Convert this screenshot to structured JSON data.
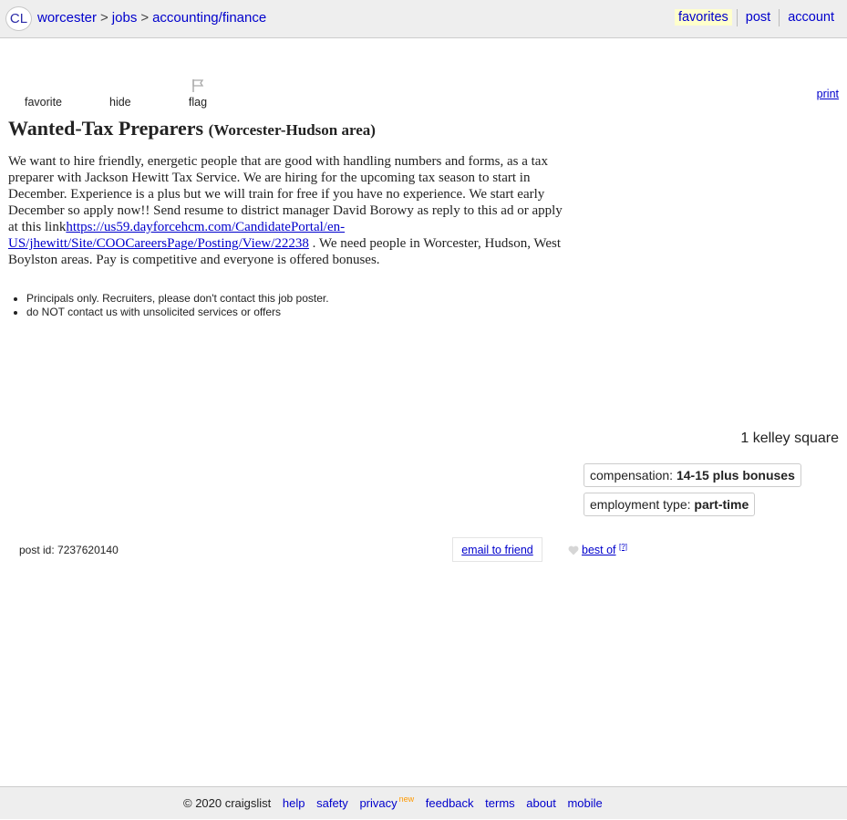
{
  "header": {
    "logo": "CL",
    "breadcrumbs": [
      "worcester",
      "jobs",
      "accounting/finance"
    ],
    "separator": ">",
    "links": {
      "favorites": "favorites",
      "post": "post",
      "account": "account"
    }
  },
  "actions": {
    "favorite": "favorite",
    "hide": "hide",
    "flag": "flag",
    "print": "print"
  },
  "post": {
    "title": "Wanted-Tax Preparers",
    "location": "(Worcester-Hudson area)",
    "body_before": "We want to hire friendly, energetic people that are good with handling numbers and forms, as a tax preparer with Jackson Hewitt Tax Service. We are hiring for the upcoming tax season to start in December. Experience is a plus but we will train for free if you have no experience. We start early December so apply now!! Send resume to district manager David Borowy as reply to this ad or apply at this link",
    "body_link": "https://us59.dayforcehcm.com/CandidatePortal/en-US/jhewitt/Site/COOCareersPage/Posting/View/22238",
    "body_after": " . We need people in Worcester, Hudson, West Boylston areas. Pay is competitive and everyone is offered bonuses.",
    "notices": [
      "Principals only. Recruiters, please don't contact this job poster.",
      "do NOT contact us with unsolicited services or offers"
    ]
  },
  "attributes": {
    "address": "1 kelley square",
    "compensation_label": "compensation: ",
    "compensation_value": "14-15 plus bonuses",
    "employment_label": "employment type: ",
    "employment_value": "part-time"
  },
  "postinfo": {
    "post_id": "post id: 7237620140",
    "email_friend": "email to friend",
    "best_of": "best of",
    "best_of_sup": "[?]"
  },
  "footer": {
    "copyright": "© 2020 craigslist",
    "links": [
      "help",
      "safety",
      "privacy",
      "feedback",
      "terms",
      "about",
      "mobile"
    ],
    "new_badge": "new"
  },
  "colors": {
    "link": "#0000cc",
    "bar": "#eeeeee",
    "favorites_highlight": "#ffffcc",
    "new_badge": "#ff9900"
  }
}
